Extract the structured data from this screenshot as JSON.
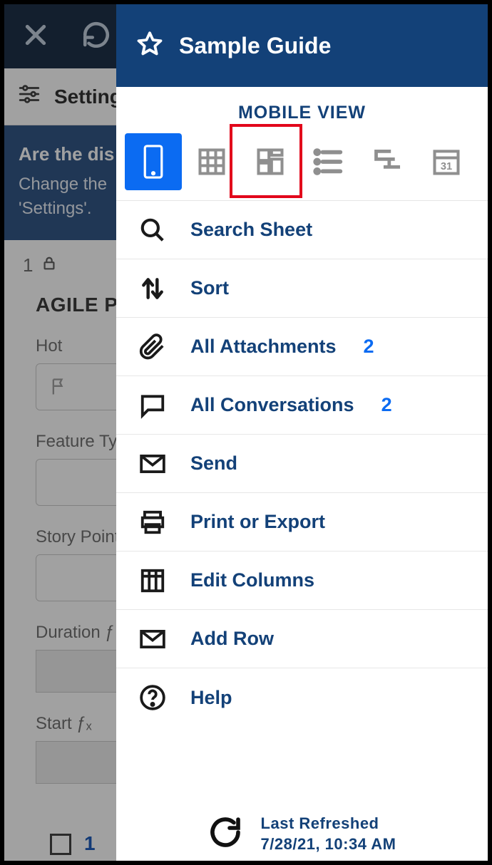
{
  "header": {
    "title": "Sample Guide",
    "mobile_view_label": "MOBILE VIEW"
  },
  "background": {
    "settings_label": "Settings",
    "banner_title": "Are the dis",
    "banner_body1": "Change the",
    "banner_body2": "'Settings'.",
    "row_number": "1",
    "section_title": "AGILE P",
    "fields": {
      "hot": "Hot",
      "feature_type": "Feature Ty",
      "story_points": "Story Point",
      "duration": "Duration  ƒ",
      "start": "Start  ƒₓ"
    },
    "bottom_number": "1"
  },
  "view_icons": [
    "mobile",
    "grid",
    "card",
    "list",
    "gantt",
    "calendar"
  ],
  "menu": [
    {
      "icon": "search",
      "label": "Search Sheet",
      "badge": ""
    },
    {
      "icon": "sort",
      "label": "Sort",
      "badge": ""
    },
    {
      "icon": "attach",
      "label": "All Attachments",
      "badge": "2"
    },
    {
      "icon": "convo",
      "label": "All Conversations",
      "badge": "2"
    },
    {
      "icon": "send",
      "label": "Send",
      "badge": ""
    },
    {
      "icon": "print",
      "label": "Print or Export",
      "badge": ""
    },
    {
      "icon": "columns",
      "label": "Edit Columns",
      "badge": ""
    },
    {
      "icon": "addrow",
      "label": "Add Row",
      "badge": ""
    },
    {
      "icon": "help",
      "label": "Help",
      "badge": ""
    }
  ],
  "refresh": {
    "label": "Last Refreshed",
    "timestamp": "7/28/21, 10:34 AM"
  }
}
